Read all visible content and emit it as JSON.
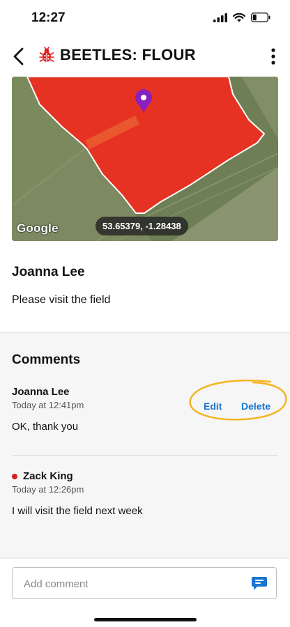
{
  "status_bar": {
    "time": "12:27"
  },
  "header": {
    "title": "BEETLES: FLOUR"
  },
  "map": {
    "provider": "Google",
    "coordinates": "53.65379, -1.28438"
  },
  "issue": {
    "author": "Joanna Lee",
    "message": "Please visit the field"
  },
  "comments": {
    "title": "Comments",
    "items": [
      {
        "author": "Joanna Lee",
        "time": "Today at 12:41pm",
        "text": "OK, thank you",
        "edit_label": "Edit",
        "delete_label": "Delete"
      },
      {
        "author": "Zack King",
        "time": "Today at 12:26pm",
        "text": "I will visit the field next week"
      }
    ]
  },
  "comment_input": {
    "placeholder": "Add comment",
    "value": ""
  },
  "colors": {
    "accent": "#1a75d2",
    "highlight": "#f5b41f",
    "pin": "#8a1fbf",
    "field": "#e53222",
    "unread_dot": "#d91e1e"
  },
  "icons": [
    "back-arrow-icon",
    "beetle-icon",
    "more-vertical-icon",
    "map-pin-icon",
    "comment-send-icon",
    "signal-icon",
    "wifi-icon",
    "battery-icon"
  ]
}
